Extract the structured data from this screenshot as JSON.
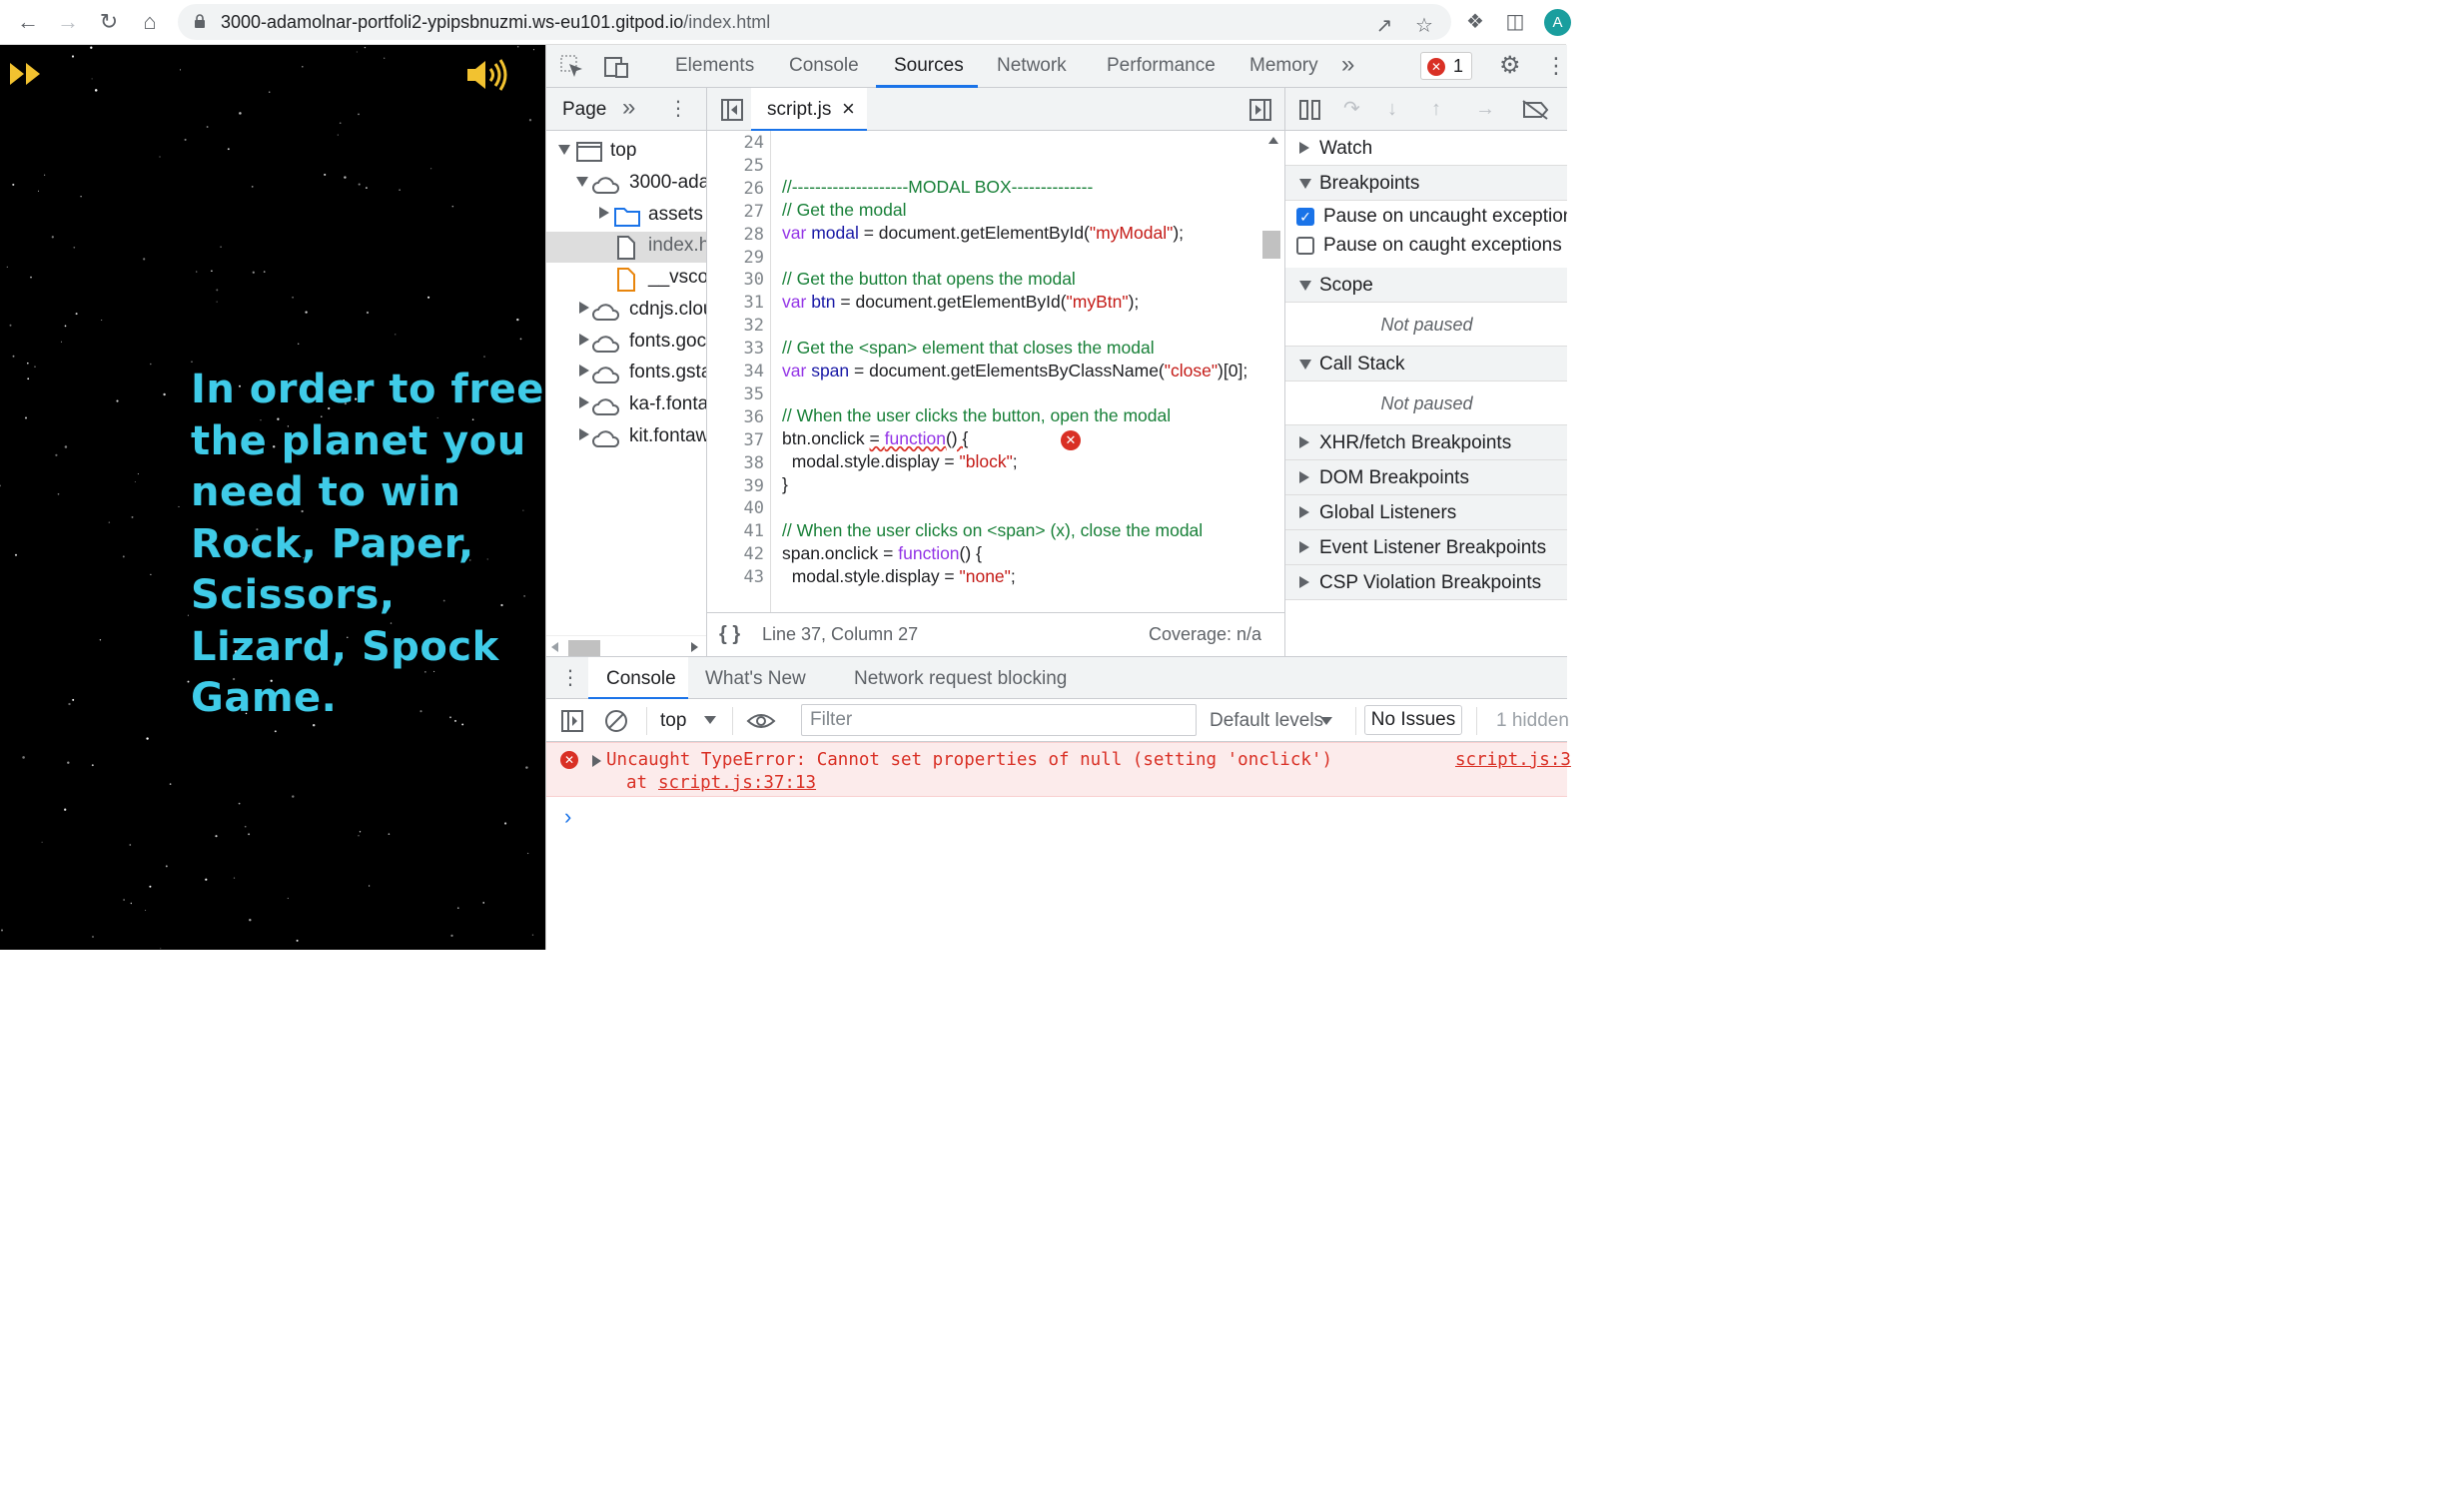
{
  "browser": {
    "url_host": "3000-adamolnar-portfoli2-ypipsbnuzmi.ws-eu101.gitpod.io",
    "url_path": "/index.html",
    "avatar_initial": "A"
  },
  "page": {
    "intro_text": "In order to free the planet you need to win Rock, Paper, Scissors, Lizard, Spock Game.",
    "accent_color": "#3fcbe8",
    "icon_color": "#f2c230"
  },
  "devtools": {
    "tabs": [
      "Elements",
      "Console",
      "Sources",
      "Network",
      "Performance",
      "Memory"
    ],
    "active_tab": "Sources",
    "error_count": "1",
    "navigator": {
      "tab_label": "Page",
      "tree": [
        {
          "label": "top"
        },
        {
          "label": "3000-ada"
        },
        {
          "label": "assets"
        },
        {
          "label": "index.h"
        },
        {
          "label": "__vsco"
        },
        {
          "label": "cdnjs.clou"
        },
        {
          "label": "fonts.goc"
        },
        {
          "label": "fonts.gsta"
        },
        {
          "label": "ka-f.fonta"
        },
        {
          "label": "kit.fontaw"
        }
      ]
    },
    "editor": {
      "file_tab": "script.js",
      "line_numbers": [
        "24",
        "25",
        "26",
        "27",
        "28",
        "29",
        "30",
        "31",
        "32",
        "33",
        "34",
        "35",
        "36",
        "37",
        "38",
        "39",
        "40",
        "41",
        "42",
        "43"
      ],
      "status_position": "Line 37, Column 27",
      "coverage": "Coverage: n/a"
    },
    "debugger": {
      "watch": "Watch",
      "breakpoints": "Breakpoints",
      "pause_uncaught": "Pause on uncaught exceptions",
      "pause_caught": "Pause on caught exceptions",
      "scope": "Scope",
      "not_paused": "Not paused",
      "call_stack": "Call Stack",
      "not_paused_2": "Not paused",
      "xhr": "XHR/fetch Breakpoints",
      "dom": "DOM Breakpoints",
      "global": "Global Listeners",
      "event": "Event Listener Breakpoints",
      "csp": "CSP Violation Breakpoints"
    },
    "drawer": {
      "tabs": [
        "Console",
        "What's New",
        "Network request blocking"
      ],
      "context": "top",
      "filter_placeholder": "Filter",
      "levels": "Default levels",
      "issues": "No Issues",
      "hidden": "1 hidden",
      "error_message": "Uncaught TypeError: Cannot set properties of null (setting 'onclick')",
      "error_at": "at",
      "error_link": "script.js:37:13",
      "error_source": "script.js:3"
    }
  }
}
